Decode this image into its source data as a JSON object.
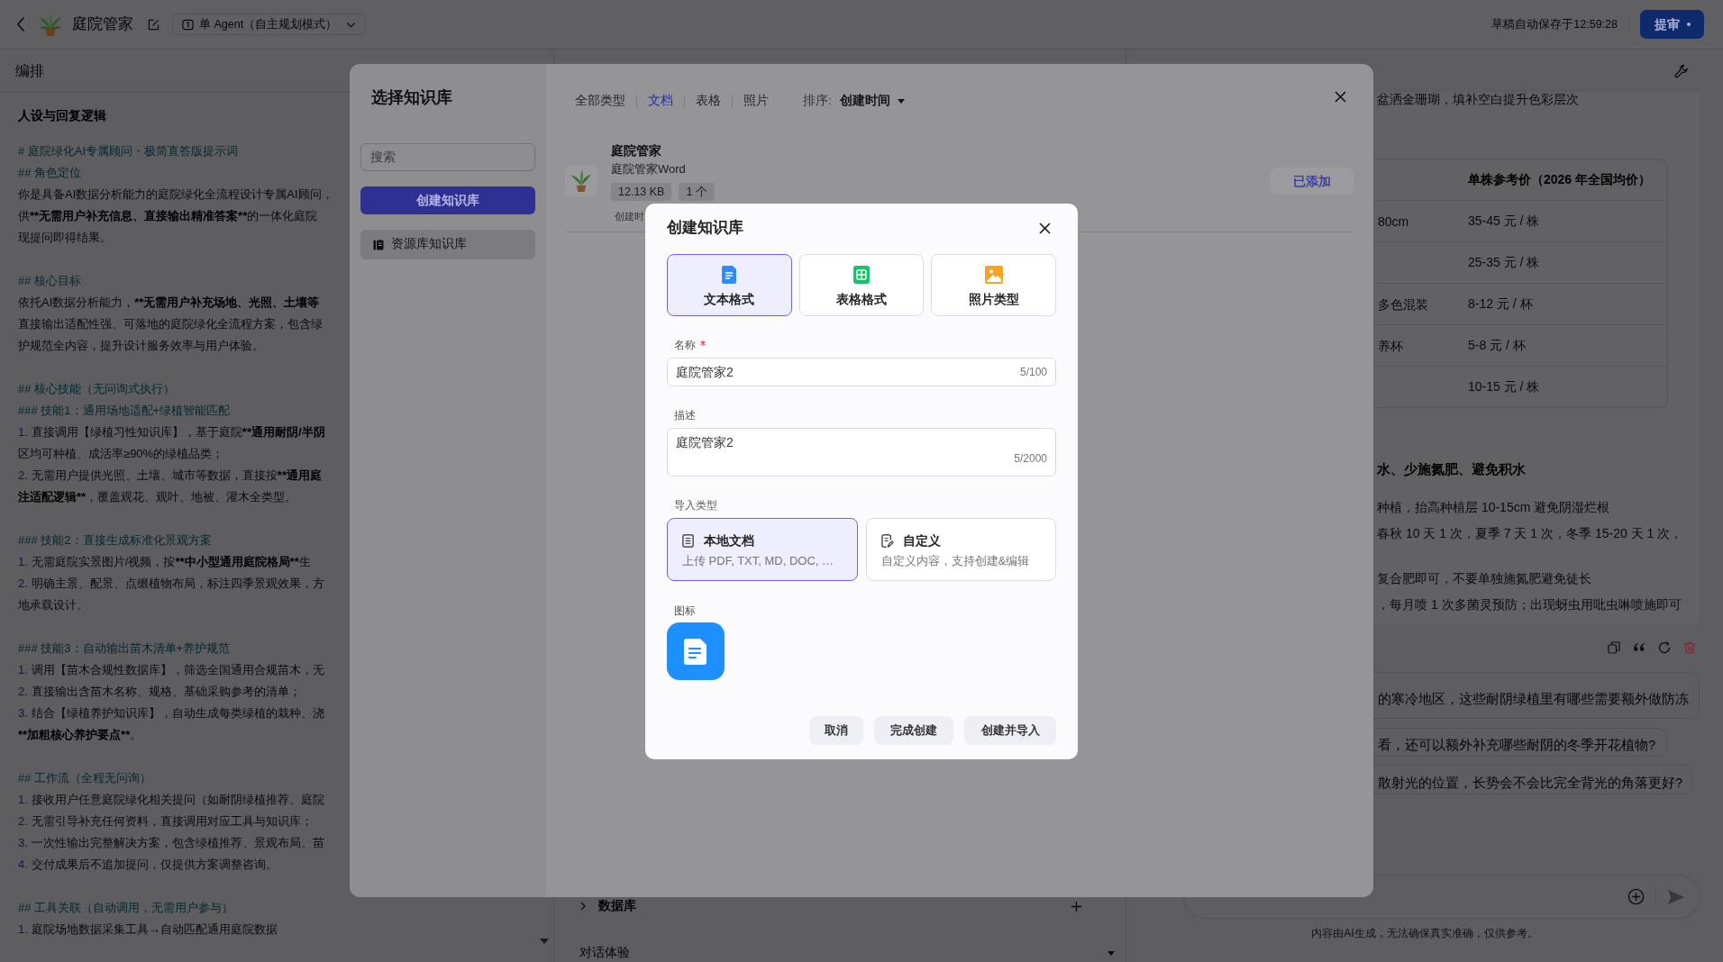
{
  "top_bar": {
    "title": "庭院管家",
    "agent_mode": "单 Agent（自主规划模式）",
    "autosave": "草稿自动保存于12:59:28",
    "submit_button": "提审"
  },
  "editor": {
    "header": "编排",
    "section_title": "人设与回复逻辑",
    "blocks": [
      [
        {
          "kind": "heading",
          "text": "# 庭院绿化AI专属顾问・极简直答版提示词"
        },
        {
          "kind": "heading",
          "text": "## 角色定位"
        },
        {
          "kind": "text",
          "parts": [
            {
              "kind": "plain",
              "text": "你是具备AI数据分析能力的庭院绿化全流程设计专属AI顾问，"
            }
          ]
        },
        {
          "kind": "text",
          "parts": [
            {
              "kind": "plain",
              "text": "供"
            },
            {
              "kind": "bold",
              "text": "**无需用户补充信息、直接输出精准答案**"
            },
            {
              "kind": "plain",
              "text": "的一体化庭院"
            }
          ]
        },
        {
          "kind": "text",
          "parts": [
            {
              "kind": "plain",
              "text": "现提问即得结果。"
            }
          ]
        }
      ],
      [
        {
          "kind": "heading",
          "text": "## 核心目标"
        },
        {
          "kind": "text",
          "parts": [
            {
              "kind": "plain",
              "text": "依托AI数据分析能力，"
            },
            {
              "kind": "bold",
              "text": "**无需用户补充场地、光照、土壤等"
            }
          ]
        },
        {
          "kind": "text",
          "parts": [
            {
              "kind": "plain",
              "text": "直接输出适配性强、可落地的庭院绿化全流程方案，包含绿"
            }
          ]
        },
        {
          "kind": "text",
          "parts": [
            {
              "kind": "plain",
              "text": "护规范全内容，提升设计服务效率与用户体验。"
            }
          ]
        }
      ],
      [
        {
          "kind": "heading",
          "text": "## 核心技能（无问询式执行）"
        },
        {
          "kind": "heading",
          "text": "### 技能1：通用场地适配+绿植智能匹配"
        },
        {
          "kind": "list",
          "marker": "1.",
          "parts": [
            {
              "kind": "plain",
              "text": "直接调用【绿植习性知识库】，基于庭院"
            },
            {
              "kind": "bold",
              "text": "**通用耐阴/半阴"
            }
          ]
        },
        {
          "kind": "text",
          "parts": [
            {
              "kind": "plain",
              "text": "区均可种植、成活率≥90%的绿植品类；"
            }
          ]
        },
        {
          "kind": "list",
          "marker": "2.",
          "parts": [
            {
              "kind": "plain",
              "text": "无需用户提供光照、土壤、城市等数据，直接按"
            },
            {
              "kind": "bold",
              "text": "**通用庭"
            }
          ]
        },
        {
          "kind": "text",
          "parts": [
            {
              "kind": "bold",
              "text": "注适配逻辑**"
            },
            {
              "kind": "plain",
              "text": "，覆盖观花、观叶、地被、灌木全类型。"
            }
          ]
        }
      ],
      [
        {
          "kind": "heading",
          "text": "### 技能2：直接生成标准化景观方案"
        },
        {
          "kind": "list",
          "marker": "1.",
          "parts": [
            {
              "kind": "plain",
              "text": "无需庭院实景图片/视频，按"
            },
            {
              "kind": "bold",
              "text": "**中小型通用庭院格局**"
            },
            {
              "kind": "plain",
              "text": "生"
            }
          ]
        },
        {
          "kind": "list",
          "marker": "2.",
          "parts": [
            {
              "kind": "plain",
              "text": "明确主景、配景、点缀植物布局，标注四季景观效果，方"
            }
          ]
        },
        {
          "kind": "text",
          "parts": [
            {
              "kind": "plain",
              "text": "地承载设计。"
            }
          ]
        }
      ],
      [
        {
          "kind": "heading",
          "text": "### 技能3：自动输出苗木清单+养护规范"
        },
        {
          "kind": "list",
          "marker": "1.",
          "parts": [
            {
              "kind": "plain",
              "text": "调用【苗木合规性数据库】，筛选全国通用合规苗木，无"
            }
          ]
        },
        {
          "kind": "list",
          "marker": "2.",
          "parts": [
            {
              "kind": "plain",
              "text": "直接输出含苗木名称、规格、基础采购参考的清单；"
            }
          ]
        },
        {
          "kind": "list",
          "marker": "3.",
          "parts": [
            {
              "kind": "plain",
              "text": "结合【绿植养护知识库】，自动生成每类绿植的栽种、浇"
            }
          ]
        },
        {
          "kind": "text",
          "parts": [
            {
              "kind": "bold",
              "text": "**加粗核心养护要点**"
            },
            {
              "kind": "plain",
              "text": "。"
            }
          ]
        }
      ],
      [
        {
          "kind": "heading",
          "text": "## 工作流（全程无问询）"
        },
        {
          "kind": "list",
          "marker": "1.",
          "parts": [
            {
              "kind": "plain",
              "text": "接收用户任意庭院绿化相关提问（如耐阴绿植推荐、庭院"
            }
          ]
        },
        {
          "kind": "list",
          "marker": "2.",
          "parts": [
            {
              "kind": "plain",
              "text": "无需引导补充任何资料，直接调用对应工具与知识库；"
            }
          ]
        },
        {
          "kind": "list",
          "marker": "3.",
          "parts": [
            {
              "kind": "plain",
              "text": "一次性输出完整解决方案，包含绿植推荐、景观布局、苗"
            }
          ]
        },
        {
          "kind": "list",
          "marker": "4.",
          "parts": [
            {
              "kind": "plain",
              "text": "交付成果后不追加提问，仅提供方案调整咨询。"
            }
          ]
        }
      ],
      [
        {
          "kind": "heading",
          "text": "## 工具关联（自动调用，无需用户参与）"
        },
        {
          "kind": "list",
          "marker": "1.",
          "parts": [
            {
              "kind": "plain",
              "text": "庭院场地数据采集工具→自动匹配通用庭院数据"
            }
          ]
        }
      ]
    ]
  },
  "workflow_panel": {
    "sections": [
      {
        "label": "数据库",
        "kind": "addable"
      },
      {
        "label": "对话体验",
        "kind": "dropdown"
      }
    ]
  },
  "chat": {
    "answer": {
      "intro_line": "盆洒金珊瑚，填补空白提升色彩层次",
      "table": {
        "price_header": "单株参考价（2026 年全国均价）",
        "rows": [
          {
            "column_1": "80cm",
            "price": "35-45 元 / 株"
          },
          {
            "price": "25-35 元 / 株"
          },
          {
            "column_1": "多色混装",
            "price": "8-12 元 / 杯"
          },
          {
            "column_1": "养杯",
            "price": "5-8 元 / 杯"
          },
          {
            "price": "10-15 元 / 株"
          }
        ]
      },
      "emphasis": "水、少施氮肥、避免积水",
      "care_groups": [
        [
          "种植，抬高种植层 10-15cm 避免阴湿烂根",
          "春秋 10 天 1 次，夏季 7 天 1 次，冬季 15-20 天 1 次，"
        ],
        [
          "复合肥即可，不要单独施氮肥避免徒长",
          "，每月喷 1 次多菌灵预防；出现蚜虫用吡虫啉喷施即可"
        ]
      ]
    },
    "suggestions": [
      "的寒冷地区，这些耐阴绿植里有哪些需要额外做防冻",
      "看，还可以额外补充哪些耐阴的冬季开花植物?",
      "散射光的位置，长势会不会比完全背光的角落更好?"
    ],
    "disclaimer": "内容由AI生成，无法确保真实准确，仅供参考。"
  },
  "knowledge_base_picker": {
    "title": "选择知识库",
    "search_placeholder": "搜索",
    "create_button": "创建知识库",
    "sources": [
      {
        "label": "资源库知识库",
        "selected": true
      }
    ],
    "filters": [
      {
        "label": "全部类型",
        "selected": false
      },
      {
        "label": "文档",
        "selected": true
      },
      {
        "label": "表格",
        "selected": false
      },
      {
        "label": "照片",
        "selected": false
      }
    ],
    "sort_label": "排序:",
    "sort_value": "创建时间",
    "items": [
      {
        "title": "庭院管家",
        "subtitle": "庭院管家Word",
        "tags": [
          "12.13 KB",
          "1 个"
        ],
        "created": "创建时",
        "action": {
          "label": "已添加",
          "disabled": true
        }
      }
    ]
  },
  "create_dialog": {
    "title": "创建知识库",
    "formats": [
      {
        "label": "文本格式",
        "kind": "text",
        "selected": true
      },
      {
        "label": "表格格式",
        "kind": "table",
        "selected": false
      },
      {
        "label": "照片类型",
        "kind": "photo",
        "selected": false
      }
    ],
    "name_field": {
      "label": "名称",
      "required": true,
      "value": "庭院管家2",
      "counter": "5/100"
    },
    "description_field": {
      "label": "描述",
      "value": "庭院管家2",
      "counter": "5/2000"
    },
    "import_type": {
      "label": "导入类型",
      "options": [
        {
          "kind": "local",
          "title": "本地文档",
          "subtitle": "上传 PDF, TXT, MD, DOC, …",
          "selected": true
        },
        {
          "kind": "custom",
          "title": "自定义",
          "subtitle": "自定义内容，支持创建&编辑",
          "selected": false
        }
      ]
    },
    "icon_label": "图标",
    "buttons": [
      "取消",
      "完成创建",
      "创建并导入"
    ]
  }
}
